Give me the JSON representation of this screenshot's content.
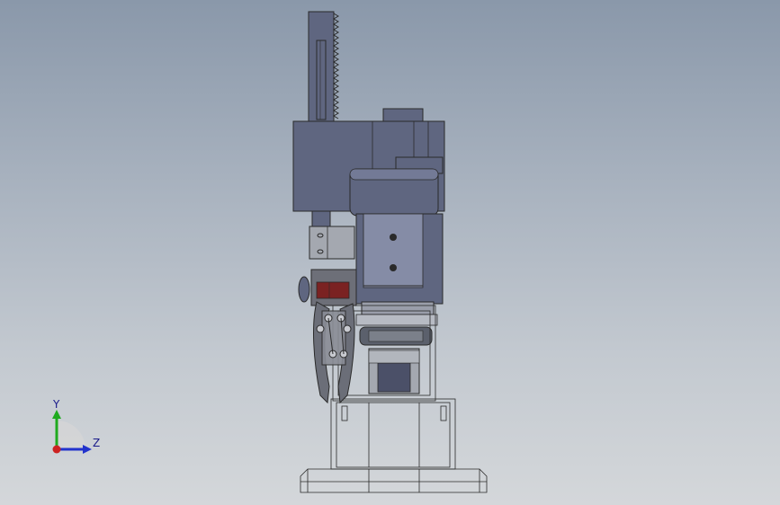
{
  "viewport": {
    "background_top": "#8a98aa",
    "background_bottom": "#d4d7da"
  },
  "model": {
    "body_color": "#5f6680",
    "body_dark": "#4b5068",
    "shadow_color": "#3a3e50",
    "wire_color": "#2a2a2a",
    "accent_red": "#7a2222",
    "gray_part": "#a4a8b0"
  },
  "triad": {
    "y_label": "Y",
    "z_label": "Z",
    "y_color": "#1faa1f",
    "z_color": "#2233cc",
    "origin_color": "#cc2222"
  }
}
